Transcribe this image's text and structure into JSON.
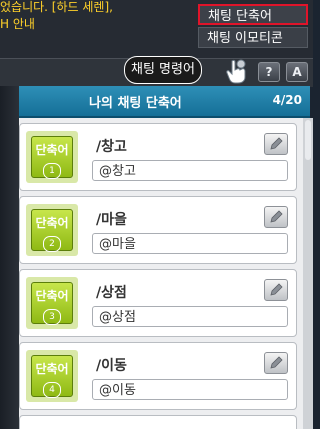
{
  "chat": {
    "line1": "었습니다. [하드 세렌],",
    "line2": "H 안내"
  },
  "popup_menu": {
    "items": [
      {
        "label": "채팅 단축어",
        "selected": true
      },
      {
        "label": "채팅 이모티콘",
        "selected": false
      }
    ]
  },
  "toolbar": {
    "command_tooltip": "채팅 명령어",
    "help_label": "?",
    "close_label": "A"
  },
  "panel": {
    "title": "나의 채팅 단축어",
    "count": "4/20"
  },
  "shortcuts": [
    {
      "badge": "단축어",
      "num": "1",
      "name": "/창고",
      "value": "@창고"
    },
    {
      "badge": "단축어",
      "num": "2",
      "name": "/마을",
      "value": "@마을"
    },
    {
      "badge": "단축어",
      "num": "3",
      "name": "/상점",
      "value": "@상점"
    },
    {
      "badge": "단축어",
      "num": "4",
      "name": "/이동",
      "value": "@이동"
    }
  ],
  "colors": {
    "accent_red": "#e0142a",
    "header_blue": "#1a7ca6",
    "badge_green": "#9cc31e",
    "chat_yellow": "#ffd12a"
  }
}
